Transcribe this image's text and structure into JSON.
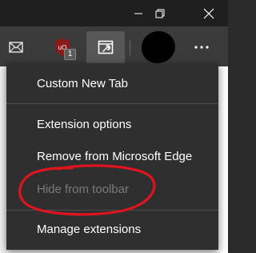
{
  "titlebar": {
    "minimize_icon": "minimize-icon",
    "maximize_icon": "restore-icon",
    "close_icon": "close-icon"
  },
  "toolbar": {
    "extensions": [
      {
        "name": "mail",
        "icon": "mail-icon"
      },
      {
        "name": "ublock",
        "icon": "ublock-icon",
        "badge": "1"
      },
      {
        "name": "custom-new-tab",
        "icon": "custom-new-tab-icon",
        "active": true
      }
    ],
    "more_icon": "more-horizontal-icon"
  },
  "menu": {
    "items": [
      {
        "label": "Custom New Tab",
        "enabled": true
      },
      {
        "label": "Extension options",
        "enabled": true
      },
      {
        "label": "Remove from Microsoft Edge",
        "enabled": true
      },
      {
        "label": "Hide from toolbar",
        "enabled": false
      },
      {
        "label": "Manage extensions",
        "enabled": true
      }
    ]
  },
  "colors": {
    "menu_bg": "#2f2f2f",
    "toolbar_bg": "#3b3b3b",
    "disabled_text": "#7a7a7a",
    "annotation": "#e0141e"
  }
}
